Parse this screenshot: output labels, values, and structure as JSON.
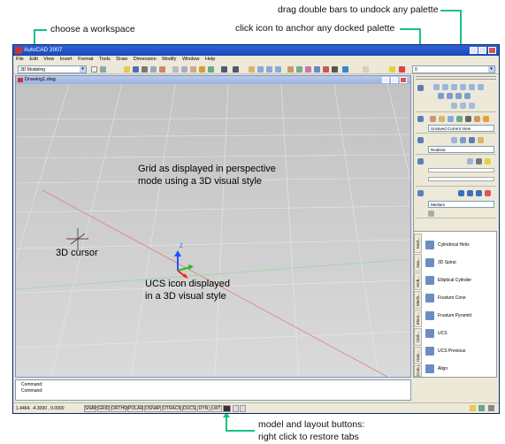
{
  "callouts": {
    "workspace": "choose a workspace",
    "undock": "drag double bars to undock any palette",
    "anchor": "click icon to anchor any docked palette",
    "model_layout_1": "model and layout buttons:",
    "model_layout_2": "right click to restore tabs"
  },
  "app": {
    "title": "AutoCAD 2007"
  },
  "menu": [
    "File",
    "Edit",
    "View",
    "Insert",
    "Format",
    "Tools",
    "Draw",
    "Dimension",
    "Modify",
    "Window",
    "Help"
  ],
  "workspace": {
    "value": "3D Modeling"
  },
  "layer": {
    "value": "0"
  },
  "drawing": {
    "title": "Drawing1.dwg"
  },
  "viewport_notes": {
    "grid_1": "Grid as displayed in perspective",
    "grid_2": "mode using a 3D visual style",
    "cursor": "3D cursor",
    "ucs_1": "UCS icon displayed",
    "ucs_2": "in a 3D visual style",
    "ucs_z": "Z"
  },
  "dashboard": {
    "view": "Unsaved Current View",
    "visual_style": "Realistic",
    "material": "Medium"
  },
  "tool_palette": {
    "tabs": [
      "Mod...",
      "Ann...",
      "Arch...",
      "Mech...",
      "Elect...",
      "Civil...",
      "Hatc...",
      "Com..."
    ],
    "items": [
      "Cylindrical Helix",
      "3D Spiral",
      "Elliptical Cylinder",
      "Frustum Cone",
      "Frustum Pyramid",
      "UCS",
      "UCS Previous",
      "Align"
    ]
  },
  "command": {
    "lines": [
      "Command:",
      "Command:"
    ]
  },
  "status": {
    "coords": "1.4464, -4.3000 , 0.0000",
    "buttons": [
      "SNAP",
      "GRID",
      "ORTHO",
      "POLAR",
      "OSNAP",
      "OTRACK",
      "DUCS",
      "DYN",
      "LWT",
      "MODEL"
    ]
  },
  "colors": {
    "callout_line": "#17c27e",
    "title_blue": "#1a48b8",
    "axis_x": "#ff2020",
    "axis_y": "#20c020",
    "axis_z": "#2050ff"
  }
}
